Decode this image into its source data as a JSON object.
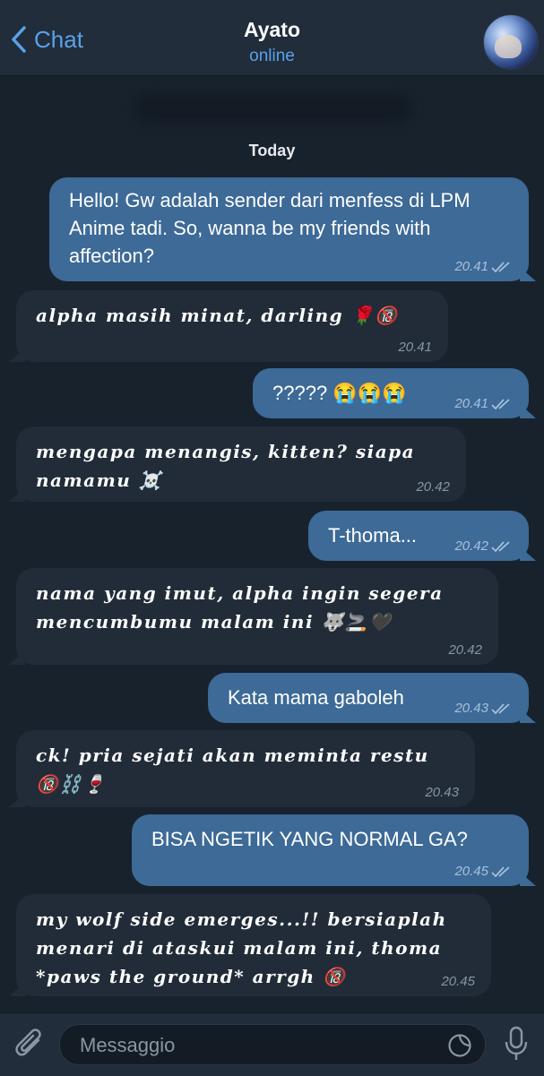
{
  "header": {
    "back_label": "Chat",
    "contact_name": "Ayato",
    "contact_status": "online"
  },
  "date_separator": "Today",
  "messages": [
    {
      "dir": "out",
      "text": "Hello! Gw adalah sender dari menfess di LPM Anime tadi. So, wanna be my friends with affection?",
      "time": "20.41",
      "read": true
    },
    {
      "dir": "in",
      "text": "alpha masih minat, darling 🌹🔞",
      "time": "20.41"
    },
    {
      "dir": "out",
      "text": "????? 😭😭😭",
      "time": "20.41",
      "read": true
    },
    {
      "dir": "in",
      "text": "mengapa menangis, kitten? siapa namamu ☠️",
      "time": "20.42"
    },
    {
      "dir": "out",
      "text": "T-thoma...",
      "time": "20.42",
      "read": true
    },
    {
      "dir": "in",
      "text": "nama yang imut, alpha ingin segera mencumbumu malam ini 🐺🚬🖤",
      "time": "20.42"
    },
    {
      "dir": "out",
      "text": "Kata mama gaboleh",
      "time": "20.43",
      "read": true
    },
    {
      "dir": "in",
      "text": "ck! pria sejati akan meminta restu 🔞⛓️🍷",
      "time": "20.43"
    },
    {
      "dir": "out",
      "text": "BISA NGETIK YANG NORMAL GA?",
      "time": "20.45",
      "read": true
    },
    {
      "dir": "in",
      "text": "my wolf side emerges...!! bersiaplah menari di ataskui malam ini, thoma *paws the ground* arrgh 🔞",
      "time": "20.45"
    }
  ],
  "composer": {
    "placeholder": "Messaggio"
  },
  "colors": {
    "background": "#18222d",
    "outgoing_bubble": "#3d6a97",
    "incoming_bubble": "#212c38",
    "accent": "#5aa1ea"
  }
}
